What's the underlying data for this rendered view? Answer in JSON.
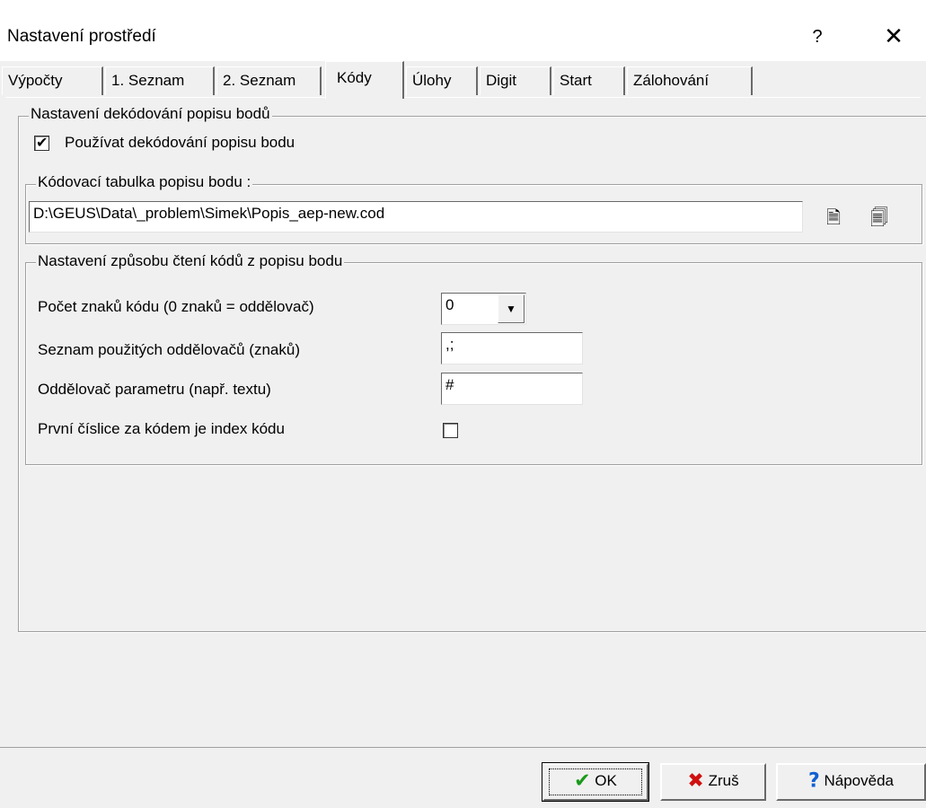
{
  "window": {
    "title": "Nastavení prostředí",
    "help_glyph": "?",
    "close_glyph": "✕"
  },
  "tabs": [
    {
      "label": "Výpočty"
    },
    {
      "label": "1. Seznam"
    },
    {
      "label": "2. Seznam"
    },
    {
      "label": "Kódy",
      "active": true
    },
    {
      "label": "Úlohy"
    },
    {
      "label": "Digit"
    },
    {
      "label": "Start"
    },
    {
      "label": "Zálohování"
    }
  ],
  "decoding": {
    "group_label": "Nastavení dekódování popisu bodů",
    "use_decoding_label": "Používat dekódování popisu bodu",
    "use_decoding_checked": true
  },
  "code_table": {
    "group_label": "Kódovací tabulka popisu bodu :",
    "path_value": "D:\\GEUS\\Data\\_problem\\Simek\\Popis_aep-new.cod",
    "open_icon": "file-open-icon",
    "edit_icon": "file-edit-icon"
  },
  "reading": {
    "group_label": "Nastavení způsobu čtení kódů z popisu bodu",
    "code_length_label": "Počet znaků kódu (0 znaků = oddělovač)",
    "code_length_value": "0",
    "separators_label": "Seznam použitých oddělovačů (znaků)",
    "separators_value": ",;",
    "param_separator_label": "Oddělovač parametru (např. textu)",
    "param_separator_value": "#",
    "first_digit_label": "První číslice za kódem je index kódu",
    "first_digit_checked": false
  },
  "buttons": {
    "ok_label": "OK",
    "cancel_label": "Zruš",
    "help_label": "Nápověda",
    "ok_icon": "checkmark-icon",
    "cancel_icon": "x-icon",
    "help_icon": "question-icon",
    "ok_color": "#1a9a1a",
    "cancel_color": "#d01010",
    "help_color": "#1060d0"
  }
}
